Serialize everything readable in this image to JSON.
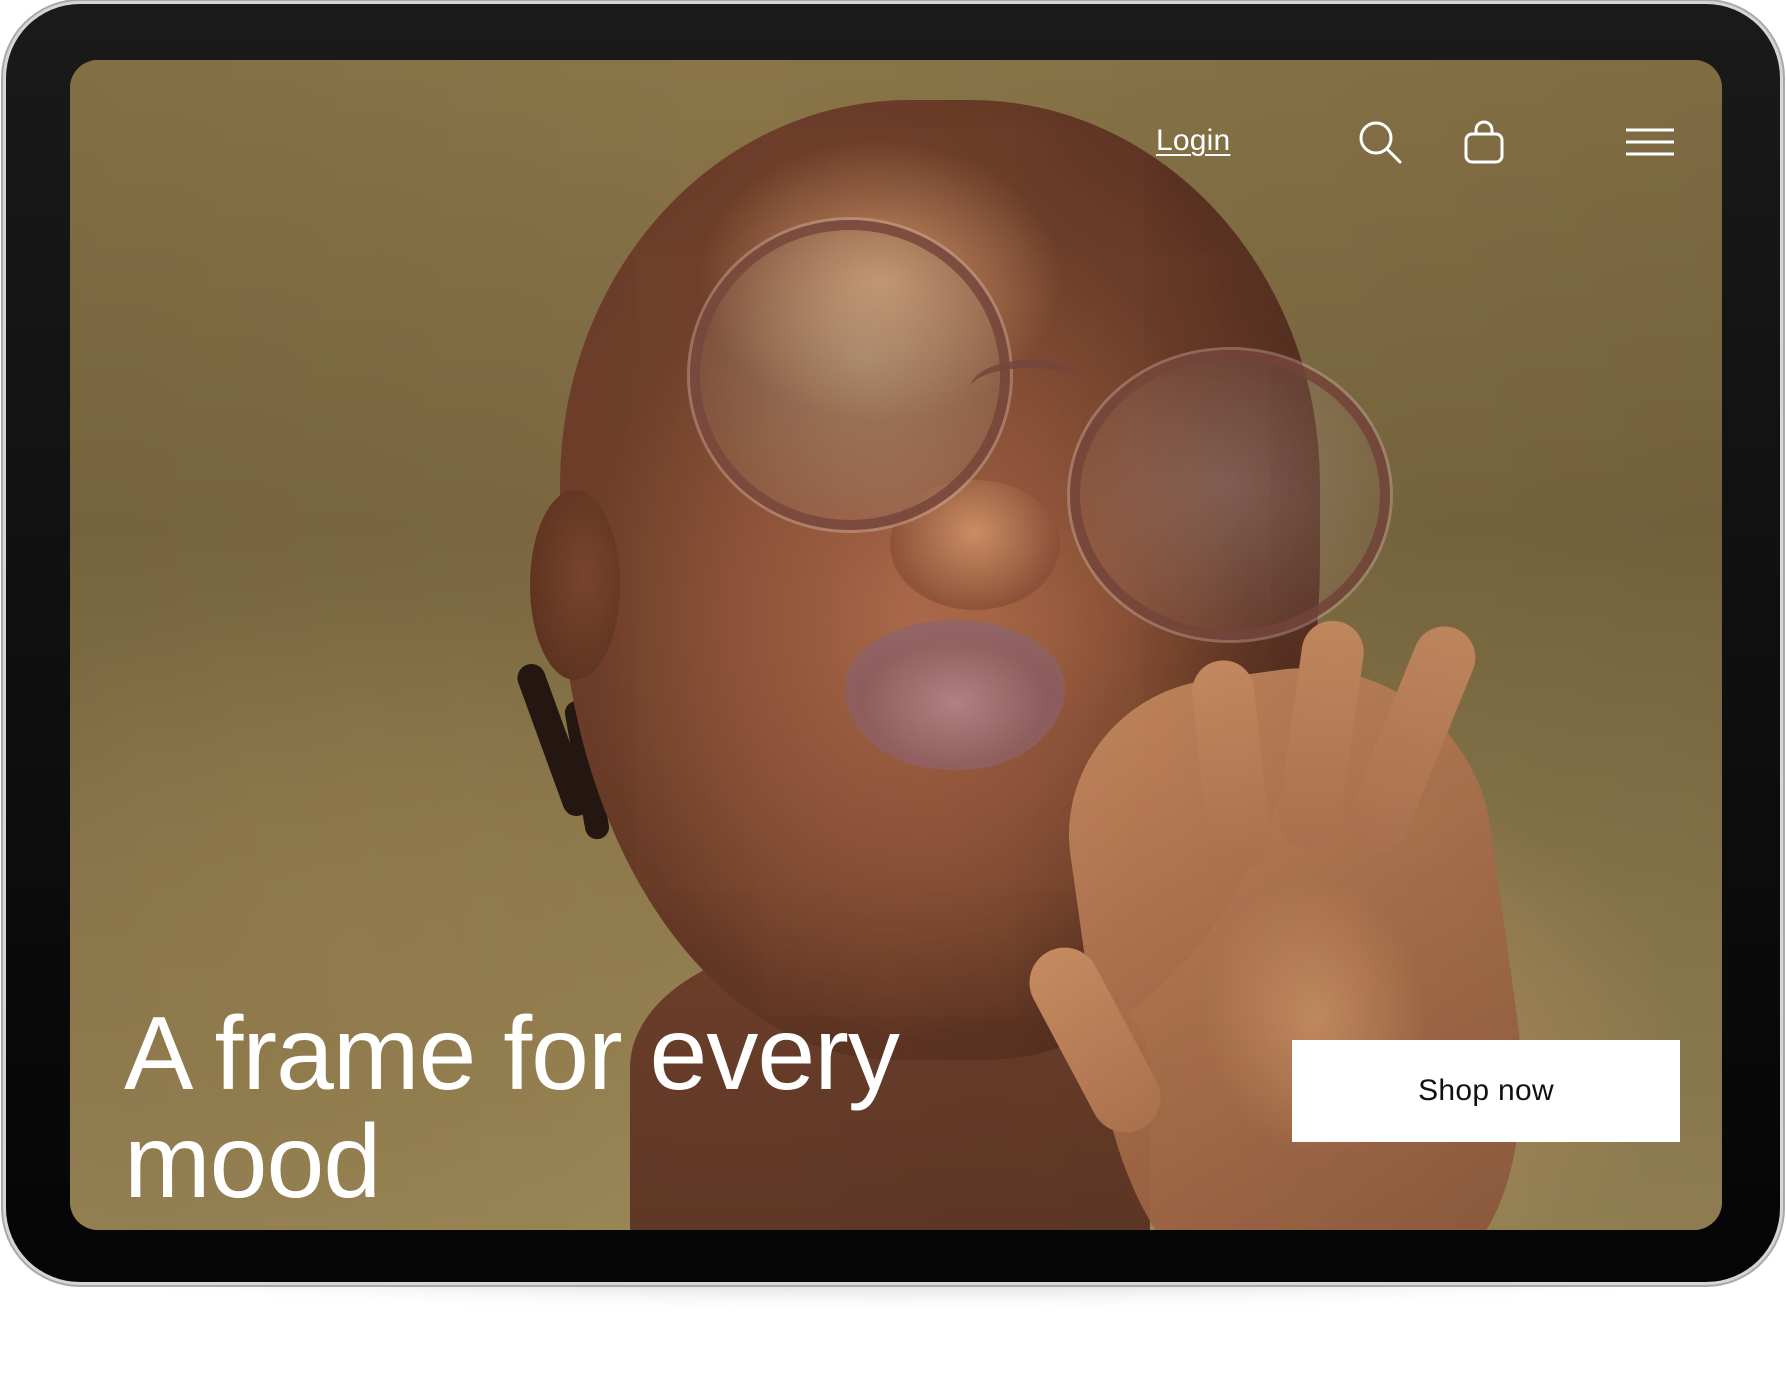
{
  "nav": {
    "login_label": "Login",
    "search_icon": "search-icon",
    "bag_icon": "shopping-bag-icon",
    "menu_icon": "hamburger-menu-icon"
  },
  "hero": {
    "headline": "A frame for every mood",
    "cta_label": "Shop now"
  },
  "colors": {
    "overlay_text": "#ffffff",
    "button_bg": "#ffffff",
    "button_text": "#111111",
    "device_bezel": "#0a0a0a"
  }
}
